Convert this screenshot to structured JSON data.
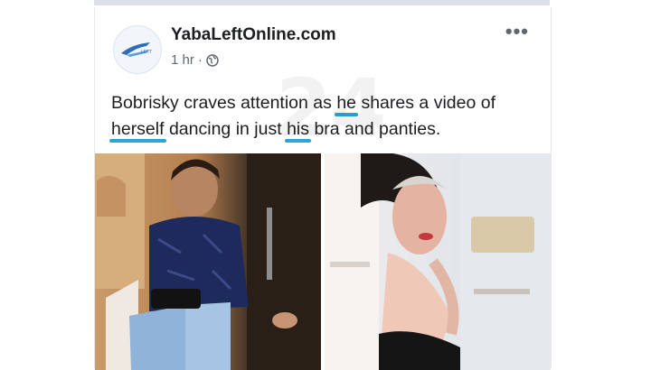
{
  "post": {
    "page_name": "YabaLeftOnline.com",
    "time": "1 hr",
    "separator": "·",
    "more": "•••",
    "avatar_icon": "yabaleft-logo-icon",
    "privacy_icon": "globe-icon",
    "text_words": [
      "Bobrisky",
      "craves",
      "attention",
      "as",
      "he",
      "shares",
      "a",
      "video",
      "of",
      "herself",
      "dancing",
      "in",
      "just",
      "his",
      "bra",
      "and",
      "panties."
    ],
    "underlined_words": [
      "he",
      "herself",
      "his"
    ],
    "underline_color": "#2aa6d8"
  },
  "media": {
    "photos": [
      "photo-seated-person",
      "photo-selfie-person"
    ]
  }
}
